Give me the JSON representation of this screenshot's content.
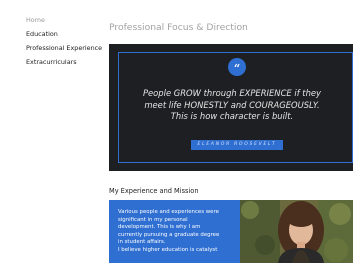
{
  "sidebar": {
    "items": [
      {
        "label": "Home"
      },
      {
        "label": "Education"
      },
      {
        "label": "Professional Experience"
      },
      {
        "label": "Extracurriculars"
      }
    ]
  },
  "page": {
    "title": "Professional Focus & Direction"
  },
  "quote": {
    "icon": "quote-icon",
    "lines": [
      "People GROW through EXPERIENCE if they",
      "meet life HONESTLY and COURAGEOUSLY.",
      "This is how character is built."
    ],
    "author": "ELEANOR ROOSEVELT"
  },
  "mission": {
    "heading": "My Experience and Mission",
    "lines": [
      "Various people and experiences were",
      "significant in my personal",
      "development. This is why I am",
      "currently pursuing a graduate degree",
      "in student affairs.",
      "I believe higher education is catalyst"
    ]
  },
  "colors": {
    "accent": "#2f6fd2",
    "quote_background": "#1d1f22",
    "muted_text": "#a3a3a3"
  }
}
